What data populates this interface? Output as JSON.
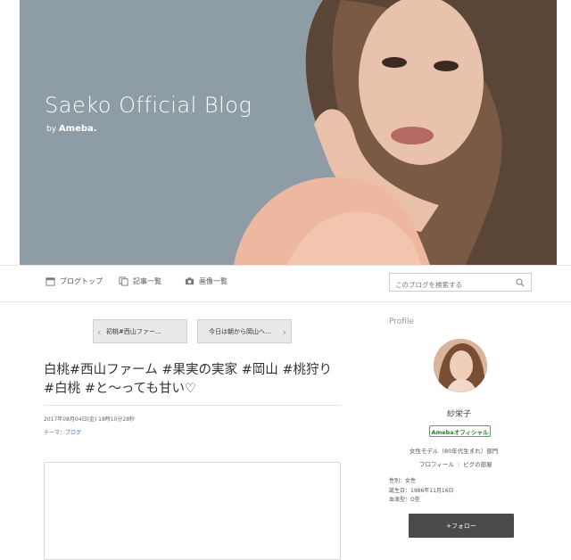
{
  "header": {
    "title": "Saeko Official Blog",
    "by": "by",
    "brand": "Ameba."
  },
  "nav": {
    "blog_top": "ブログトップ",
    "articles": "記事一覧",
    "images": "画像一覧",
    "search_placeholder": "このブログを検索する"
  },
  "pager": {
    "prev": "初桃#西山ファー…",
    "next": "今日は朝から岡山へ…"
  },
  "article": {
    "title": "白桃#西山ファーム #果実の実家 #岡山 #桃狩り #白桃 #と〜っても甘い♡",
    "date": "2017年08月04日(金) 18時10分28秒",
    "theme_label": "テーマ：",
    "theme_value": "ブログ"
  },
  "sidebar": {
    "heading": "Profile",
    "name": "紗栄子",
    "official": "Amebaオフィシャル",
    "description": "女性モデル（80年代生まれ）部門",
    "profile_link": "プロフィール",
    "pigg_link": "ピグの部屋",
    "gender": "性別：女性",
    "birthday": "誕生日：1986年11月16日",
    "blood": "血液型：O型",
    "follow": "+フォロー"
  },
  "colors": {
    "header_bg": "#8f9ea7",
    "link": "#3b6fb8",
    "official_green": "#4caf50",
    "follow_bg": "#4a4a4a"
  }
}
